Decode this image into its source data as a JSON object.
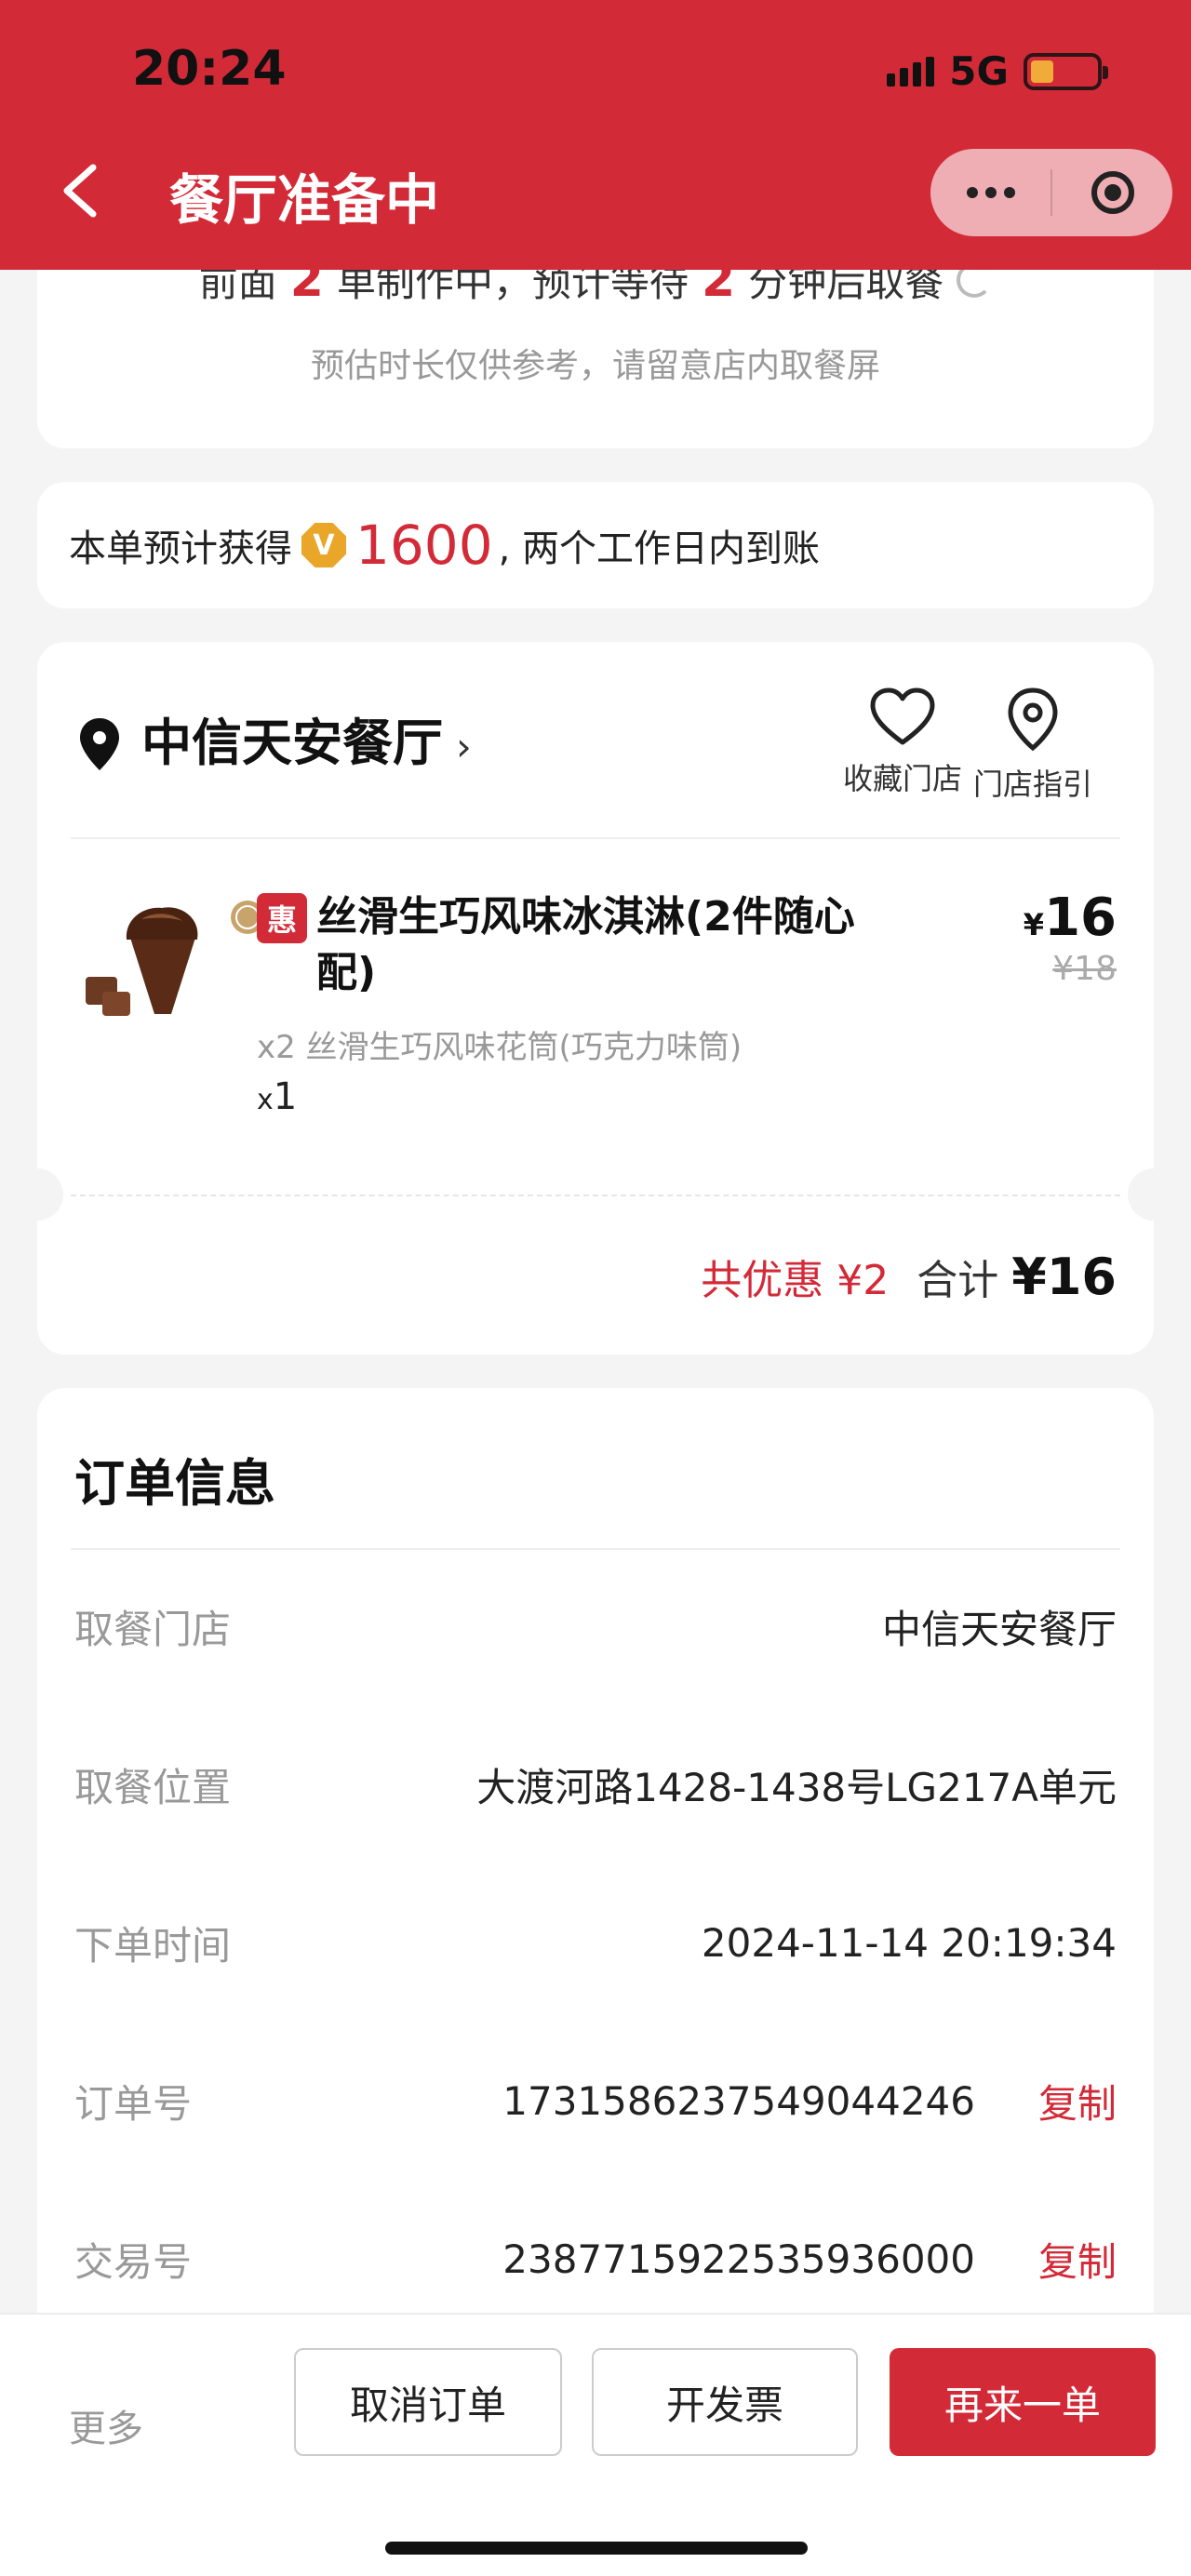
{
  "status_bar": {
    "time": "20:24",
    "network": "5G"
  },
  "header": {
    "title": "餐厅准备中"
  },
  "waiting": {
    "prefix": "前面",
    "orders_ahead": "2",
    "middle": "单制作中，预计等待",
    "minutes": "2",
    "suffix": "分钟后取餐",
    "note": "预估时长仅供参考，请留意店内取餐屏"
  },
  "points": {
    "prefix": "本单预计获得",
    "coin_letter": "V",
    "amount": "1600",
    "suffix": ", 两个工作日内到账"
  },
  "store": {
    "name": "中信天安餐厅",
    "favorite_label": "收藏门店",
    "guide_label": "门店指引"
  },
  "product": {
    "badge": "惠",
    "name": "丝滑生巧风味冰淇淋(2件随心配)",
    "detail": "x2 丝滑生巧风味花筒(巧克力味筒)",
    "qty_prefix": "x",
    "qty": "1",
    "currency": "¥",
    "price": "16",
    "original_price": "¥18"
  },
  "totals": {
    "discount": "共优惠 ¥2",
    "total_label": "合计",
    "total": "¥16"
  },
  "order_info": {
    "title": "订单信息",
    "rows": [
      {
        "label": "取餐门店",
        "value": "中信天安餐厅"
      },
      {
        "label": "取餐位置",
        "value": "大渡河路1428-1438号LG217A单元"
      },
      {
        "label": "下单时间",
        "value": "2024-11-14 20:19:34"
      },
      {
        "label": "订单号",
        "value": "1731586237549044246",
        "action": "复制"
      },
      {
        "label": "交易号",
        "value": "2387715922535936000",
        "action": "复制"
      }
    ]
  },
  "bottom_bar": {
    "more": "更多",
    "cancel": "取消订单",
    "invoice": "开发票",
    "reorder": "再来一单"
  },
  "colors": {
    "brand_red": "#d32a38",
    "coin": "#e9a628"
  }
}
